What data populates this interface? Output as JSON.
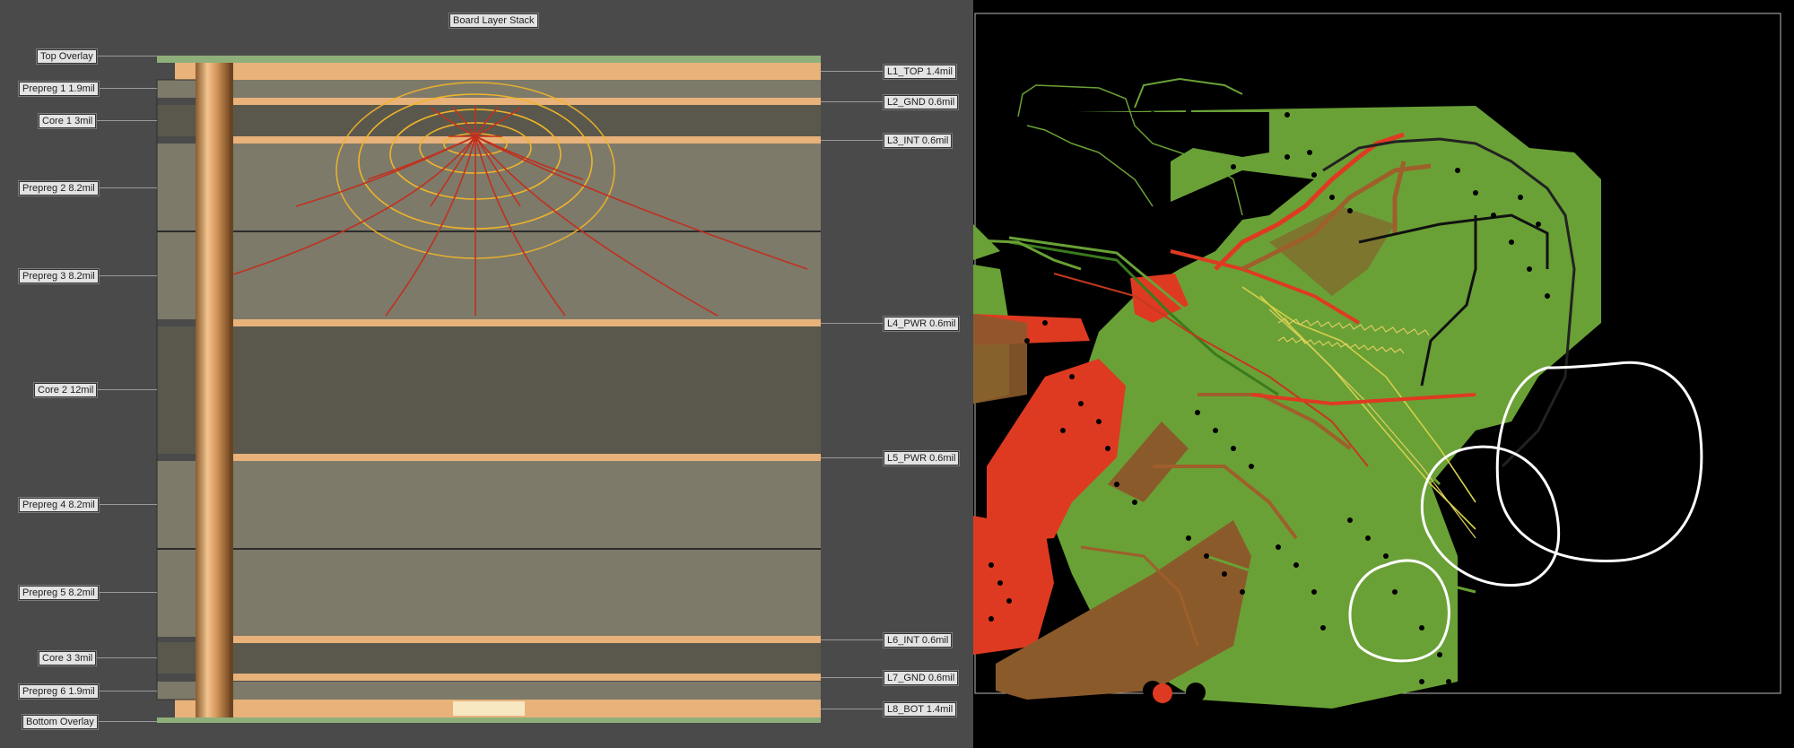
{
  "title": "Board Layer Stack",
  "left_labels": [
    "Top Overlay",
    "Prepreg 1 1.9mil",
    "Core 1 3mil",
    "Prepreg 2 8.2mil",
    "Prepreg 3 8.2mil",
    "Core 2 12mil",
    "Prepreg 4 8.2mil",
    "Prepreg 5 8.2mil",
    "Core 3 3mil",
    "Prepreg 6 1.9mil",
    "Bottom Overlay"
  ],
  "right_labels": [
    "L1_TOP 1.4mil",
    "L2_GND 0.6mil",
    "L3_INT 0.6mil",
    "L4_PWR 0.6mil",
    "L5_PWR 0.6mil",
    "L6_INT 0.6mil",
    "L7_GND 0.6mil",
    "L8_BOT 1.4mil"
  ],
  "colors": {
    "copper": "#e8b27a",
    "dielectric": "#7d7a6a",
    "core": "#5a584c",
    "pcb_green": "#6aa136",
    "pcb_red": "#de3a22",
    "pcb_brown": "#8b5a2b",
    "field_red": "#c0301f",
    "field_yellow": "#f0b429",
    "annotation_white": "#ffffff"
  },
  "icons": [
    "via-barrel-icon"
  ]
}
